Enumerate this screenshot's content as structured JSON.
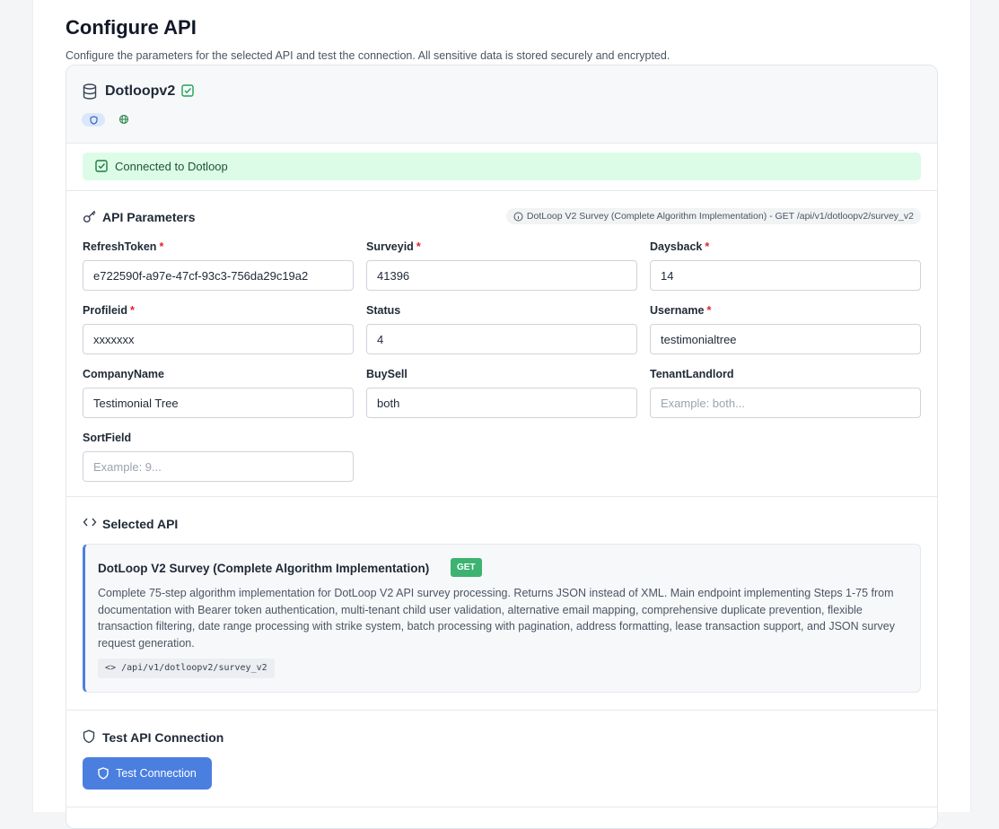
{
  "page": {
    "title": "Configure API",
    "subtitle": "Configure the parameters for the selected API and test the connection. All sensitive data is stored securely and encrypted."
  },
  "api": {
    "name": "Dotloopv2",
    "icons": [
      "database-icon",
      "check-square-icon",
      "shield-icon",
      "globe-icon"
    ]
  },
  "status": {
    "text": "Connected to Dotloop",
    "color": "#dcfce7"
  },
  "parameters": {
    "title": "API Parameters",
    "endpoint_info": "DotLoop V2 Survey (Complete Algorithm Implementation) - GET /api/v1/dotloopv2/survey_v2",
    "fields": [
      {
        "label": "RefreshToken",
        "required": "*",
        "value": "e722590f-a97e-47cf-93c3-756da29c19a2",
        "placeholder": ""
      },
      {
        "label": "Surveyid",
        "required": "*",
        "value": "41396",
        "placeholder": ""
      },
      {
        "label": "Daysback",
        "required": "*",
        "value": "14",
        "placeholder": ""
      },
      {
        "label": "Profileid",
        "required": "*",
        "value": "xxxxxxx",
        "placeholder": ""
      },
      {
        "label": "Status",
        "required": "",
        "value": "4",
        "placeholder": ""
      },
      {
        "label": "Username",
        "required": "*",
        "value": "testimonialtree",
        "placeholder": ""
      },
      {
        "label": "CompanyName",
        "required": "",
        "value": "Testimonial Tree",
        "placeholder": ""
      },
      {
        "label": "BuySell",
        "required": "",
        "value": "both",
        "placeholder": ""
      },
      {
        "label": "TenantLandlord",
        "required": "",
        "value": "",
        "placeholder": "Example: both..."
      },
      {
        "label": "SortField",
        "required": "",
        "value": "",
        "placeholder": "Example: 9..."
      }
    ]
  },
  "selected_api": {
    "section_title": "Selected API",
    "name": "DotLoop V2 Survey (Complete Algorithm Implementation)",
    "method": "GET",
    "description": "Complete 75-step algorithm implementation for DotLoop V2 API survey processing. Returns JSON instead of XML. Main endpoint implementing Steps 1-75 from documentation with Bearer token authentication, multi-tenant child user validation, alternative email mapping, comprehensive duplicate prevention, flexible transaction filtering, date range processing with strike system, batch processing with pagination, address formatting, lease transaction support, and JSON survey request generation.",
    "path": "/api/v1/dotloopv2/survey_v2"
  },
  "test": {
    "section_title": "Test API Connection",
    "button_label": "Test Connection"
  },
  "colors": {
    "accent": "#4a7fe0",
    "success_bg": "#dcfce7",
    "success_text": "#1e5631",
    "get_badge": "#3cb371",
    "required": "#dc2626"
  }
}
